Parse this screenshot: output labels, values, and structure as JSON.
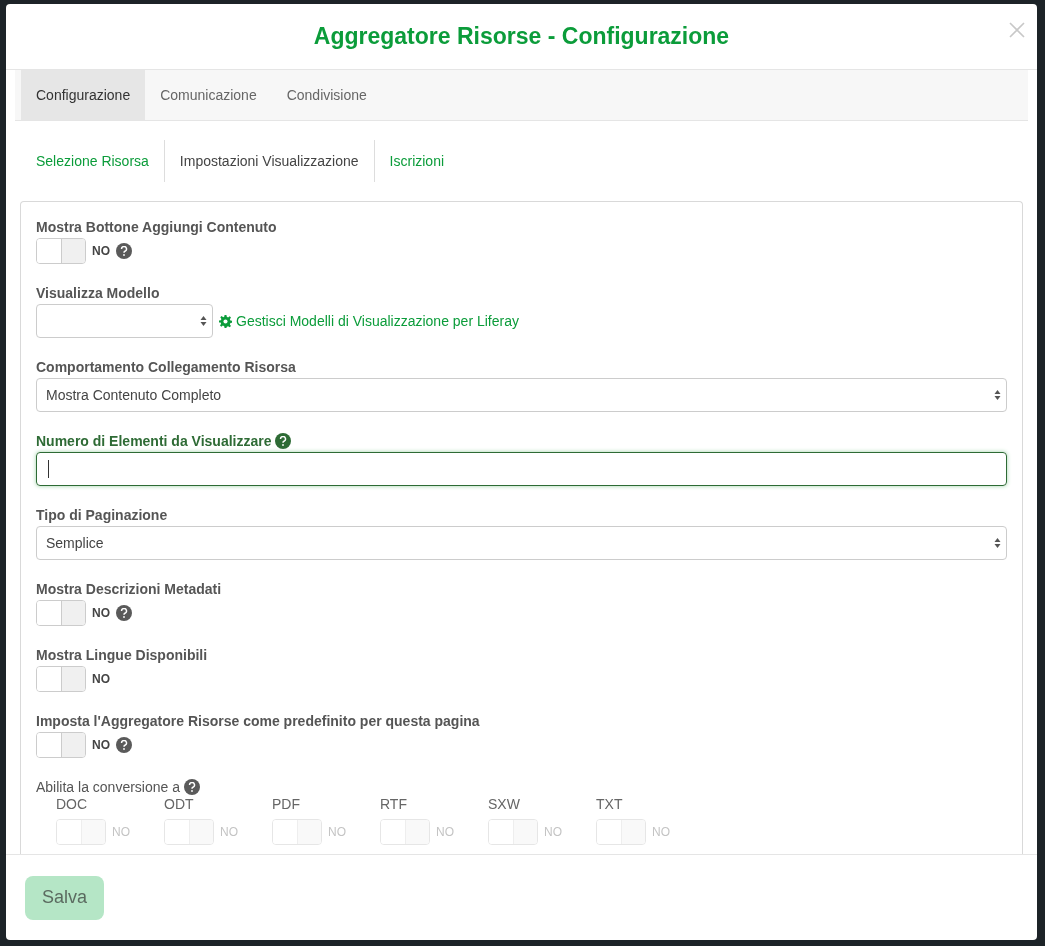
{
  "modal": {
    "title": "Aggregatore Risorse - Configurazione"
  },
  "tabs": [
    {
      "label": "Configurazione",
      "selected": true
    },
    {
      "label": "Comunicazione",
      "selected": false
    },
    {
      "label": "Condivisione",
      "selected": false
    }
  ],
  "subtabs": [
    {
      "label": "Selezione Risorsa",
      "selected": false
    },
    {
      "label": "Impostazioni Visualizzazione",
      "selected": true
    },
    {
      "label": "Iscrizioni",
      "selected": false
    }
  ],
  "fields": [
    {
      "kind": "toggle",
      "label": "Mostra Bottone Aggiungi Contenuto",
      "on": false,
      "state_text": "NO",
      "help": true
    },
    {
      "kind": "select",
      "label": "Visualizza Modello",
      "full": false,
      "link": "Gestisci Modelli di Visualizzazione per Liferay"
    },
    {
      "kind": "select",
      "label": "Comportamento Collegamento Risorsa",
      "value": "Mostra Contenuto Completo",
      "full": true
    },
    {
      "kind": "text",
      "label": "Numero di Elementi da Visualizzare",
      "help": true,
      "focused": true
    },
    {
      "kind": "select",
      "label": "Tipo di Paginazione",
      "value": "Semplice",
      "full": true
    },
    {
      "kind": "toggle",
      "label": "Mostra Descrizioni Metadati",
      "on": false,
      "state_text": "NO",
      "help": true
    },
    {
      "kind": "toggle",
      "label": "Mostra Lingue Disponibili",
      "on": false,
      "state_text": "NO",
      "help": false
    },
    {
      "kind": "toggle",
      "label": "Imposta l'Aggregatore Risorse come predefinito per questa pagina",
      "on": false,
      "state_text": "NO",
      "help": true
    },
    {
      "kind": "conversion",
      "label": "Abilita la conversione a",
      "help": true,
      "options": [
        {
          "label": "DOC",
          "on": false,
          "disabled": true,
          "state_text": "NO"
        },
        {
          "label": "ODT",
          "on": false,
          "disabled": true,
          "state_text": "NO"
        },
        {
          "label": "PDF",
          "on": false,
          "disabled": true,
          "state_text": "NO"
        },
        {
          "label": "RTF",
          "on": false,
          "disabled": true,
          "state_text": "NO"
        },
        {
          "label": "SXW",
          "on": false,
          "disabled": true,
          "state_text": "NO"
        },
        {
          "label": "TXT",
          "on": false,
          "disabled": true,
          "state_text": "NO"
        }
      ]
    }
  ],
  "footer": {
    "save_button": "Salva",
    "save_disabled": true
  }
}
